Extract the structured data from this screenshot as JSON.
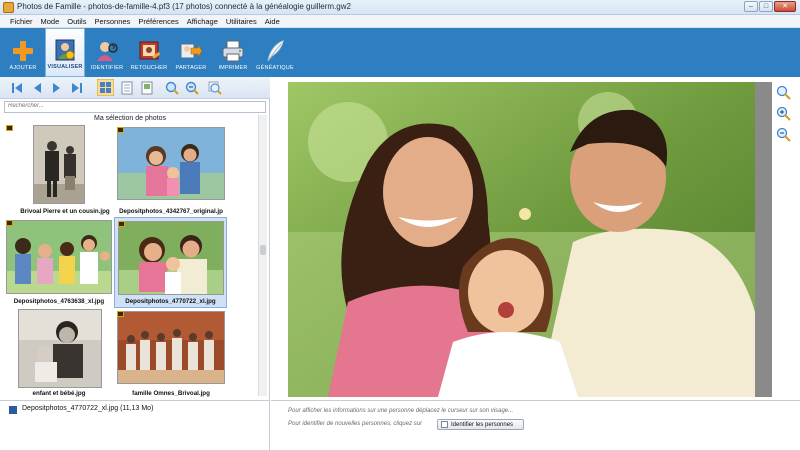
{
  "window": {
    "title": "Photos de Famille - photos-de-famille-4.pf3 (17 photos) connecté à la généalogie guillerm.gw2",
    "minimize": "–",
    "maximize": "□",
    "close": "✕"
  },
  "menu": [
    "Fichier",
    "Mode",
    "Outils",
    "Personnes",
    "Préférences",
    "Affichage",
    "Utilitaires",
    "Aide"
  ],
  "ribbon": [
    {
      "label": "AJOUTER",
      "icon": "plus-icon"
    },
    {
      "label": "VISUALISER",
      "icon": "view-portrait-icon",
      "active": true
    },
    {
      "label": "IDENTIFIER",
      "icon": "identify-person-icon"
    },
    {
      "label": "RETOUCHER",
      "icon": "retouch-frame-icon"
    },
    {
      "label": "PARTAGER",
      "icon": "share-arrow-icon"
    },
    {
      "label": "IMPRIMER",
      "icon": "printer-icon"
    },
    {
      "label": "GÉNÉATIQUE",
      "icon": "feather-icon"
    }
  ],
  "search": {
    "placeholder": "Rechercher..."
  },
  "gallery": {
    "title": "Ma sélection de photos",
    "items": [
      {
        "caption": "Brivoal Pierre et un cousin.jpg"
      },
      {
        "caption": "Depositphotos_4342767_original.jp"
      },
      {
        "caption": "Depositphotos_4763638_xl.jpg"
      },
      {
        "caption": "Depositphotos_4770722_xl.jpg",
        "selected": true
      },
      {
        "caption": "enfant et bébé.jpg"
      },
      {
        "caption": "famille Omnes_Brivoal.jpg"
      }
    ]
  },
  "status": {
    "selected_file": "Depositphotos_4770722_xl.jpg (11,13 Mo)"
  },
  "info": {
    "line1": "Pour afficher les informations sur une personne déplacez le curseur sur son visage...",
    "line2": "Pour identifier de nouvelles personnes, cliquez sur",
    "identify_button": "Identifier les personnes"
  },
  "colors": {
    "ribbon": "#2d7fc1",
    "accent_orange": "#f39a1e"
  }
}
